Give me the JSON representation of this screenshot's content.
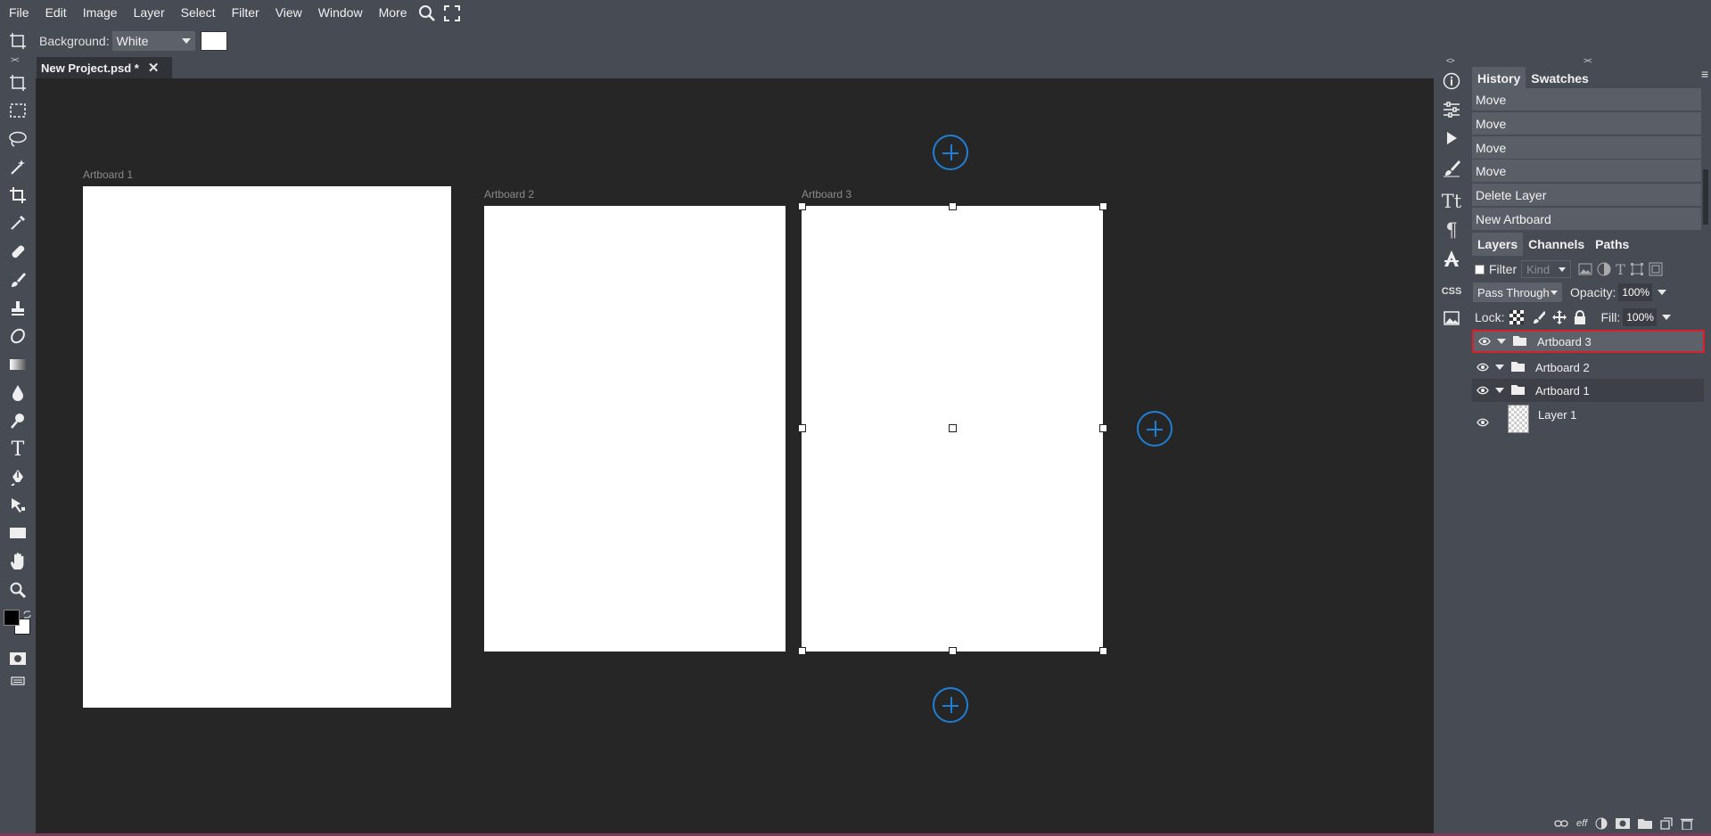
{
  "menu": {
    "items": [
      "File",
      "Edit",
      "Image",
      "Layer",
      "Select",
      "Filter",
      "View",
      "Window",
      "More"
    ],
    "search_icon": "search-icon",
    "fullscreen_icon": "fullscreen-icon"
  },
  "options": {
    "background_label": "Background:",
    "background_value": "White",
    "swatch_color": "#ffffff"
  },
  "document": {
    "tab_title": "New Project.psd *"
  },
  "canvas": {
    "artboards": [
      {
        "label": "Artboard 1"
      },
      {
        "label": "Artboard 2"
      },
      {
        "label": "Artboard 3"
      }
    ],
    "accent": "#1f7fd4"
  },
  "panels": {
    "history_tabs": [
      "History",
      "Swatches"
    ],
    "history_items": [
      "Move",
      "Move",
      "Move",
      "Move",
      "Delete Layer",
      "New Artboard"
    ],
    "layer_tabs": [
      "Layers",
      "Channels",
      "Paths"
    ],
    "filter_label": "Filter",
    "kind_placeholder": "Kind",
    "blend_mode": "Pass Through",
    "opacity_label": "Opacity:",
    "opacity_value": "100%",
    "lock_label": "Lock:",
    "fill_label": "Fill:",
    "fill_value": "100%",
    "layers": [
      {
        "name": "Artboard 3",
        "type": "group",
        "selected": true
      },
      {
        "name": "Artboard 2",
        "type": "group",
        "selected": false
      },
      {
        "name": "Artboard 1",
        "type": "group",
        "selected": false
      },
      {
        "name": "Layer 1",
        "type": "layer",
        "selected": false
      }
    ],
    "selected_border_color": "#d9202a"
  },
  "bottom_icons": [
    "link-icon",
    "effects-icon",
    "adjustment-icon",
    "mask-icon",
    "folder-icon",
    "new-layer-icon",
    "trash-icon"
  ],
  "bottom_labels": {
    "effects": "eff"
  },
  "side_strip": {
    "css_label": "CSS"
  }
}
